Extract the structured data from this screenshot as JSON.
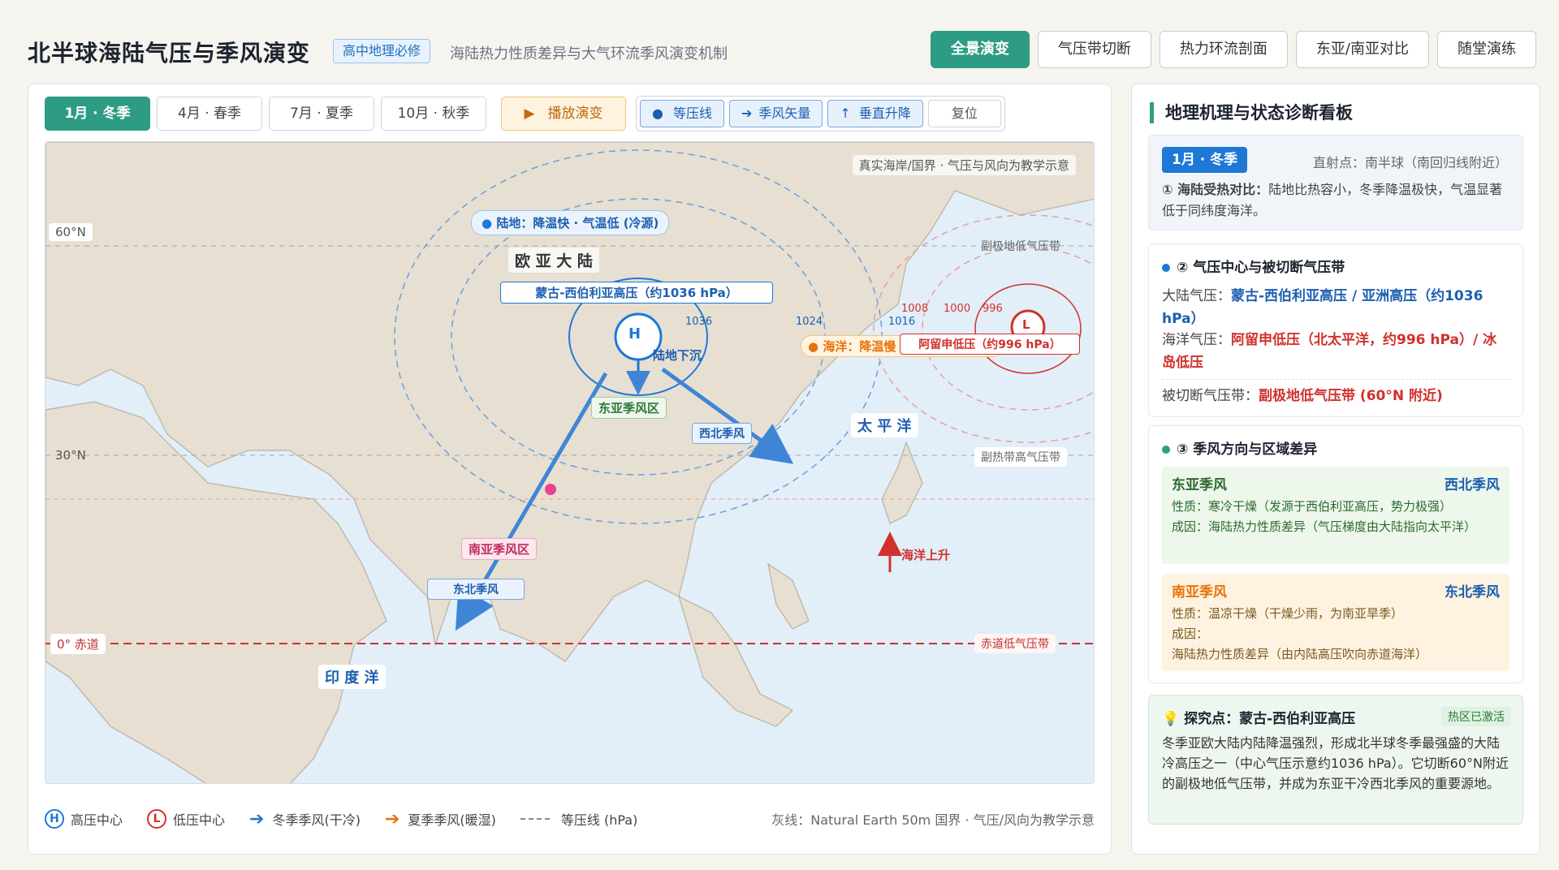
{
  "header": {
    "title": "北半球海陆气压与季风演变",
    "badge": "高中地理必修",
    "subtitle": "海陆热力性质差异与大气环流季风演变机制",
    "tabs": [
      {
        "label": "全景演变",
        "active": true
      },
      {
        "label": "气压带切断",
        "active": false
      },
      {
        "label": "热力环流剖面",
        "active": false
      },
      {
        "label": "东亚/南亚对比",
        "active": false
      },
      {
        "label": "随堂演练",
        "active": false
      }
    ]
  },
  "controls": {
    "seasons": [
      {
        "label": "1月 · 冬季",
        "active": true
      },
      {
        "label": "4月 · 春季",
        "active": false
      },
      {
        "label": "7月 · 夏季",
        "active": false
      },
      {
        "label": "10月 · 秋季",
        "active": false
      }
    ],
    "play": "播放演变",
    "toggles": [
      "等压线",
      "季风矢量",
      "垂直升降"
    ],
    "reset": "复位"
  },
  "map": {
    "note": "真实海岸/国界 · 气压与风向为教学示意",
    "lat_60": "60°N",
    "lat_30": "30°N",
    "equator": "0° 赤道",
    "land_tag": "陆地：降温快 · 气温低 (冷源)",
    "continent": "欧 亚 大 陆",
    "high_label": "蒙古-西伯利亚高压（约1036 hPa）",
    "high_symbol": "H",
    "sink": "陆地下沉",
    "isobars_high": [
      "1036",
      "1024",
      "1016"
    ],
    "isobars_low": [
      "1008",
      "1000",
      "996"
    ],
    "ocean_tag": "海洋：降温慢 · 相对温暖 (热源)",
    "low_label": "阿留申低压（约996 hPa）",
    "low_symbol": "L",
    "subpolar": "副极地低气压带",
    "subtropical": "副热带高气压带",
    "equatorial": "赤道低气压带",
    "ea_zone": "东亚季风区",
    "nw_wind": "西北季风",
    "pacific": "太 平 洋",
    "sa_zone": "南亚季风区",
    "ne_wind": "东北季风",
    "ocean_rise": "海洋上升",
    "indian": "印 度 洋"
  },
  "legend": {
    "high": "高压中心",
    "low": "低压中心",
    "winter": "冬季季风(干冷)",
    "summer": "夏季季风(暖湿)",
    "isobar": "等压线 (hPa)",
    "note": "灰线：Natural Earth 50m 国界 · 气压/风向为教学示意"
  },
  "side": {
    "title": "地理机理与状态诊断看板",
    "card1": {
      "season": "1月 · 冬季",
      "sun": "直射点：南半球（南回归线附近）",
      "label": "① 海陆受热对比：",
      "text": "陆地比热容小，冬季降温极快，气温显著低于同纬度海洋。"
    },
    "card2": {
      "heading": "② 气压中心与被切断气压带",
      "land_k": "大陆气压：",
      "land_v": "蒙古-西伯利亚高压 / 亚洲高压（约1036 hPa）",
      "sea_k": "海洋气压：",
      "sea_v": "阿留申低压（北太平洋，约996 hPa）/ 冰岛低压",
      "cut_k": "被切断气压带：",
      "cut_v": "副极地低气压带 (60°N 附近)"
    },
    "card3": {
      "heading": "③ 季风方向与区域差异",
      "ea": {
        "name": "东亚季风",
        "dir": "西北季风",
        "nature": "性质：寒冷干燥（发源于西伯利亚高压，势力极强）",
        "cause": "成因：海陆热力性质差异（气压梯度由大陆指向太平洋）"
      },
      "sa": {
        "name": "南亚季风",
        "dir": "东北季风",
        "nature": "性质：温凉干燥（干燥少雨，为南亚旱季）",
        "cause": "成因：",
        "cause2": "海陆热力性质差异（由内陆高压吹向赤道海洋）"
      }
    },
    "card4": {
      "heading": "探究点：蒙古-西伯利亚高压",
      "tag": "热区已激活",
      "text": "冬季亚欧大陆内陆降温强烈，形成北半球冬季最强盛的大陆冷高压之一（中心气压示意约1036 hPa）。它切断60°N附近的副极地低气压带，并成为东亚干冷西北季风的重要源地。"
    }
  },
  "colors": {
    "accent": "#2e9c84",
    "blue": "#1e78d6",
    "red": "#d0312d",
    "orange": "#e8730c"
  }
}
